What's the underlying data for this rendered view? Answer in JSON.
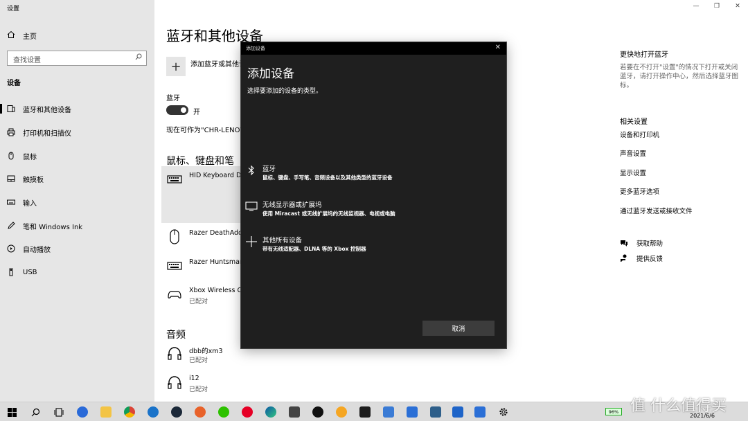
{
  "window": {
    "title": "设置",
    "controls": [
      "minimize-icon",
      "restore-icon",
      "close-icon"
    ]
  },
  "nav": {
    "home": "主页",
    "search_placeholder": "查找设置",
    "section": "设备",
    "items": [
      {
        "label": "蓝牙和其他设备",
        "icon": "bluetooth-devices-icon",
        "selected": true
      },
      {
        "label": "打印机和扫描仪",
        "icon": "printer-icon",
        "selected": false
      },
      {
        "label": "鼠标",
        "icon": "mouse-icon",
        "selected": false
      },
      {
        "label": "触摸板",
        "icon": "touchpad-icon",
        "selected": false
      },
      {
        "label": "输入",
        "icon": "keyboard-icon",
        "selected": false
      },
      {
        "label": "笔和 Windows Ink",
        "icon": "pen-icon",
        "selected": false
      },
      {
        "label": "自动播放",
        "icon": "autoplay-icon",
        "selected": false
      },
      {
        "label": "USB",
        "icon": "usb-icon",
        "selected": false
      }
    ]
  },
  "main": {
    "title": "蓝牙和其他设备",
    "add_device_label": "添加蓝牙或其他设",
    "bluetooth_label": "蓝牙",
    "bluetooth_state": "开",
    "discoverable_text": "现在可作为\"CHR-LENOVO",
    "input_section": "鼠标、键盘和笔",
    "input_devices": [
      {
        "name": "HID Keyboard Dev",
        "status": "",
        "icon": "keyboard-icon"
      },
      {
        "name": "Razer DeathAdde",
        "status": "",
        "icon": "mouse-icon"
      },
      {
        "name": "Razer Huntsman T",
        "status": "",
        "icon": "keyboard-icon"
      },
      {
        "name": "Xbox Wireless Co",
        "status": "已配对",
        "icon": "gamepad-icon"
      }
    ],
    "audio_section": "音频",
    "audio_devices": [
      {
        "name": "dbb的xm3",
        "status": "已配对",
        "icon": "headphones-icon"
      },
      {
        "name": "i12",
        "status": "已配对",
        "icon": "headphones-icon"
      }
    ]
  },
  "right": {
    "quick_title": "更快地打开蓝牙",
    "quick_desc": "若要在不打开\"设置\"的情况下打开或关闭蓝牙，请打开操作中心，然后选择蓝牙图标。",
    "related_title": "相关设置",
    "related_links": [
      "设备和打印机",
      "声音设置",
      "显示设置",
      "更多蓝牙选项",
      "通过蓝牙发送或接收文件"
    ],
    "help": "获取帮助",
    "feedback": "提供反馈"
  },
  "dialog": {
    "bar_title": "添加设备",
    "title": "添加设备",
    "subtitle": "选择要添加的设备的类型。",
    "options": [
      {
        "name": "蓝牙",
        "desc": "鼠标、键盘、手写笔、音频设备以及其他类型的蓝牙设备",
        "icon": "bluetooth-icon"
      },
      {
        "name": "无线显示器或扩展坞",
        "desc": "使用 Miracast 或无线扩展坞的无线监视器、电视或电脑",
        "icon": "monitor-icon"
      },
      {
        "name": "其他所有设备",
        "desc": "带有无线适配器、DLNA 等的 Xbox 控制器",
        "icon": "plus-icon"
      }
    ],
    "cancel": "取消"
  },
  "taskbar": {
    "battery": "96%",
    "date": "2021/6/6",
    "watermark": "值 什么值得买"
  }
}
